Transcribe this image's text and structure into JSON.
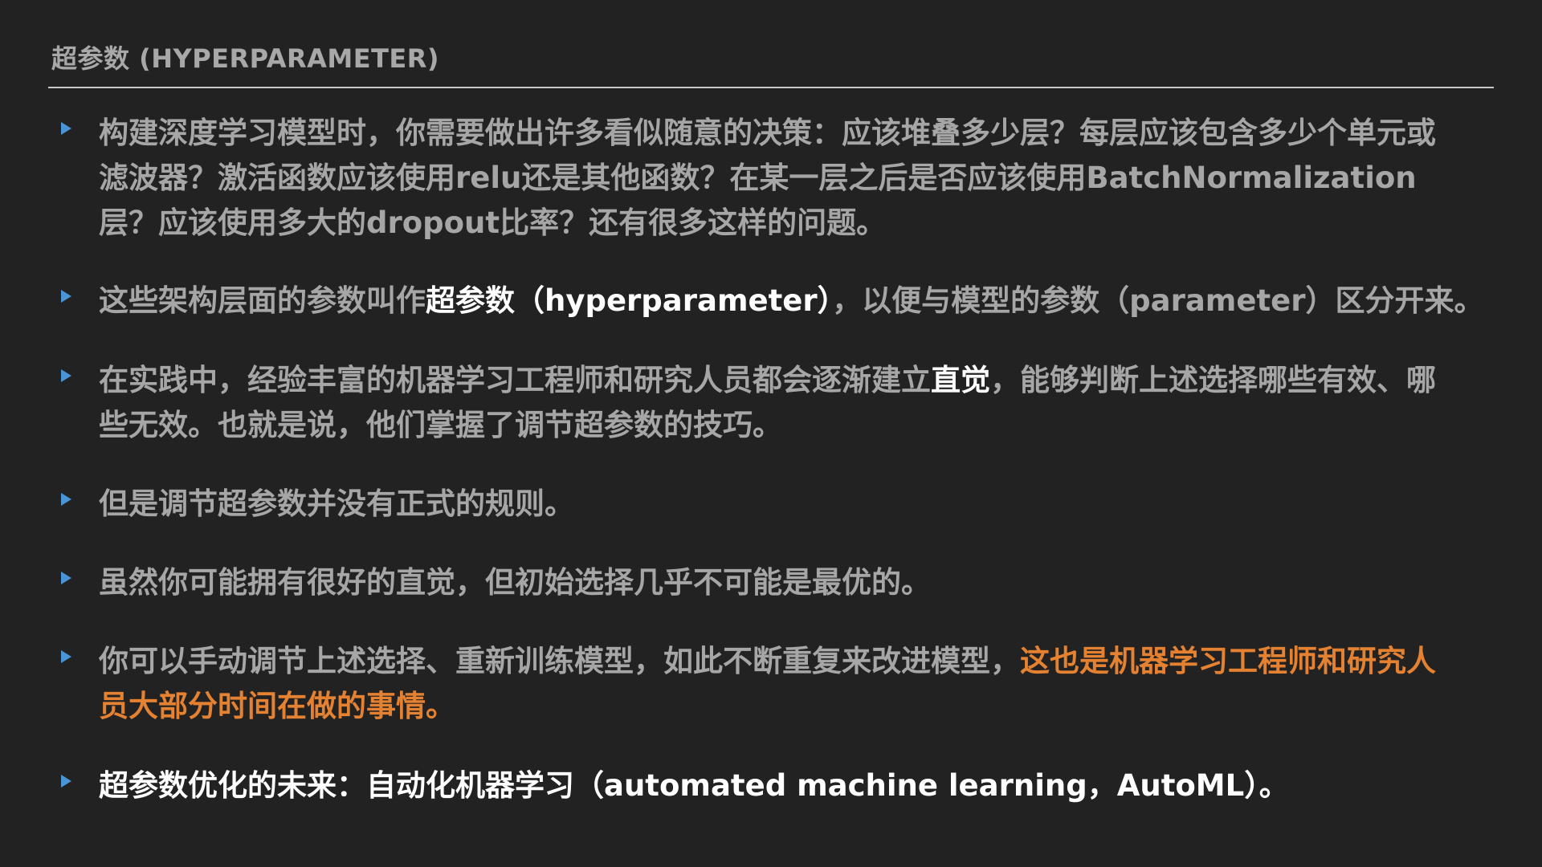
{
  "slide": {
    "title": "超参数 (HYPERPARAMETER)",
    "accent_colors": {
      "bullet": "#4a95d6",
      "emphasis": "#ffffff",
      "highlight": "#e58232",
      "body_text": "#a6a6a6",
      "background": "#222222"
    },
    "bullet_icon": "triangle-bullet-icon",
    "bullets": [
      {
        "text": "构建深度学习模型时，你需要做出许多看似随意的决策：应该堆叠多少层？每层应该包含多少个单元或滤波器？激活函数应该使用relu还是其他函数？在某一层之后是否应该使用BatchNormalization层？应该使用多大的dropout比率？还有很多这样的问题。"
      },
      {
        "part1": "这些架构层面的参数叫作",
        "bold": "超参数（hyperparameter）",
        "part2": "，以便与模型的参数（parameter）区分开来。"
      },
      {
        "part1": "在实践中，经验丰富的机器学习工程师和研究人员都会逐渐建立",
        "bold": "直觉",
        "part2": "，能够判断上述选择哪些有效、哪些无效。也就是说，他们掌握了调节超参数的技巧。"
      },
      {
        "text": "但是调节超参数并没有正式的规则。"
      },
      {
        "text": "虽然你可能拥有很好的直觉，但初始选择几乎不可能是最优的。"
      },
      {
        "part1": "你可以手动调节上述选择、重新训练模型，如此不断重复来改进模型，",
        "highlight": "这也是机器学习工程师和研究人员大部分时间在做的事情。"
      },
      {
        "text": "超参数优化的未来：自动化机器学习（automated machine learning，AutoML）。"
      }
    ]
  }
}
